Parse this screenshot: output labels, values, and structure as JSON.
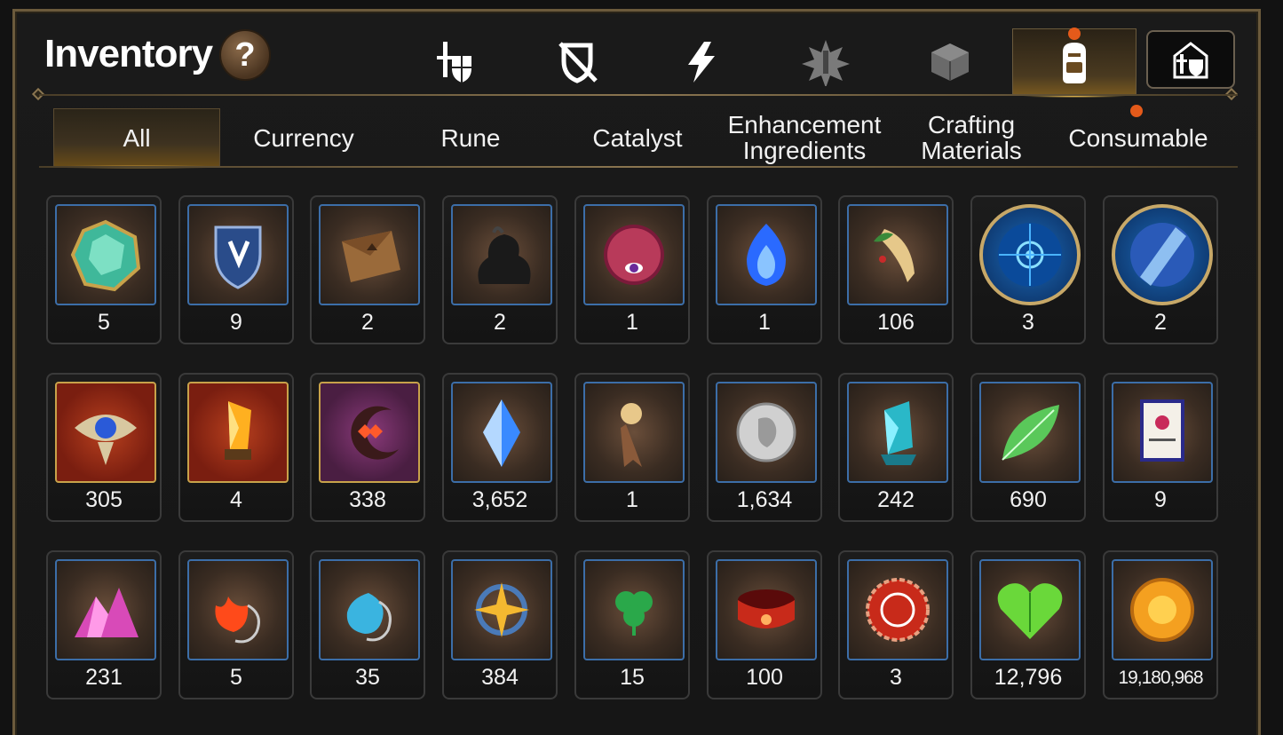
{
  "header": {
    "title": "Inventory",
    "help_label": "?"
  },
  "top_tabs": [
    {
      "name": "tab-equipment",
      "icon": "knight-shield-icon",
      "active": false,
      "badge": false
    },
    {
      "name": "tab-artifact",
      "icon": "broken-shield-icon",
      "active": false,
      "badge": false
    },
    {
      "name": "tab-skill",
      "icon": "lightning-icon",
      "active": false,
      "badge": false
    },
    {
      "name": "tab-relic",
      "icon": "burst-icon",
      "active": false,
      "badge": false
    },
    {
      "name": "tab-box",
      "icon": "cube-icon",
      "active": false,
      "badge": false
    },
    {
      "name": "tab-bag",
      "icon": "backpack-icon",
      "active": true,
      "badge": true
    }
  ],
  "home_button_icon": "castle-shield-icon",
  "sub_tabs": [
    {
      "label": "All",
      "active": true
    },
    {
      "label": "Currency",
      "active": false
    },
    {
      "label": "Rune",
      "active": false
    },
    {
      "label": "Catalyst",
      "active": false
    },
    {
      "label": "Enhancement\nIngredients",
      "active": false
    },
    {
      "label": "Crafting\nMaterials",
      "active": false
    },
    {
      "label": "Consumable",
      "active": false,
      "badge": true
    }
  ],
  "items": [
    [
      {
        "icon": "green-gem-icon",
        "count": "5"
      },
      {
        "icon": "blue-shield-icon",
        "count": "9"
      },
      {
        "icon": "leather-pouch-icon",
        "count": "2"
      },
      {
        "icon": "dark-slime-icon",
        "count": "2"
      },
      {
        "icon": "eye-orb-icon",
        "count": "1"
      },
      {
        "icon": "blue-flame-icon",
        "count": "1"
      },
      {
        "icon": "ginseng-root-icon",
        "count": "106"
      },
      {
        "icon": "blue-rune-disc-icon",
        "count": "3",
        "round": true
      },
      {
        "icon": "crystal-disc-icon",
        "count": "2",
        "round": true
      }
    ],
    [
      {
        "icon": "golden-eye-icon",
        "count": "305",
        "frame": "gold"
      },
      {
        "icon": "amber-crystal-icon",
        "count": "4",
        "frame": "gold"
      },
      {
        "icon": "crescent-flower-icon",
        "count": "338",
        "frame": "purple"
      },
      {
        "icon": "blue-crystal-icon",
        "count": "3,652"
      },
      {
        "icon": "key-bookmark-icon",
        "count": "1"
      },
      {
        "icon": "silver-coin-icon",
        "count": "1,634"
      },
      {
        "icon": "teal-crystal-icon",
        "count": "242"
      },
      {
        "icon": "green-leaf-icon",
        "count": "690"
      },
      {
        "icon": "card-icon",
        "count": "9"
      }
    ],
    [
      {
        "icon": "pink-crystal-pile-icon",
        "count": "231"
      },
      {
        "icon": "fire-pendant-icon",
        "count": "5"
      },
      {
        "icon": "water-pendant-icon",
        "count": "35"
      },
      {
        "icon": "star-pendant-icon",
        "count": "384"
      },
      {
        "icon": "clover-pendant-icon",
        "count": "15"
      },
      {
        "icon": "red-bracelet-icon",
        "count": "100"
      },
      {
        "icon": "red-badge-icon",
        "count": "3"
      },
      {
        "icon": "green-heart-icon",
        "count": "12,796"
      },
      {
        "icon": "sun-coin-icon",
        "count": "19,180,968",
        "small": true
      }
    ]
  ],
  "colors": {
    "frame_border": "#6b5a3c",
    "slot_border": "#3c6ea8",
    "active_glow": "#ffc34a",
    "badge_dot": "#e45a1a"
  }
}
